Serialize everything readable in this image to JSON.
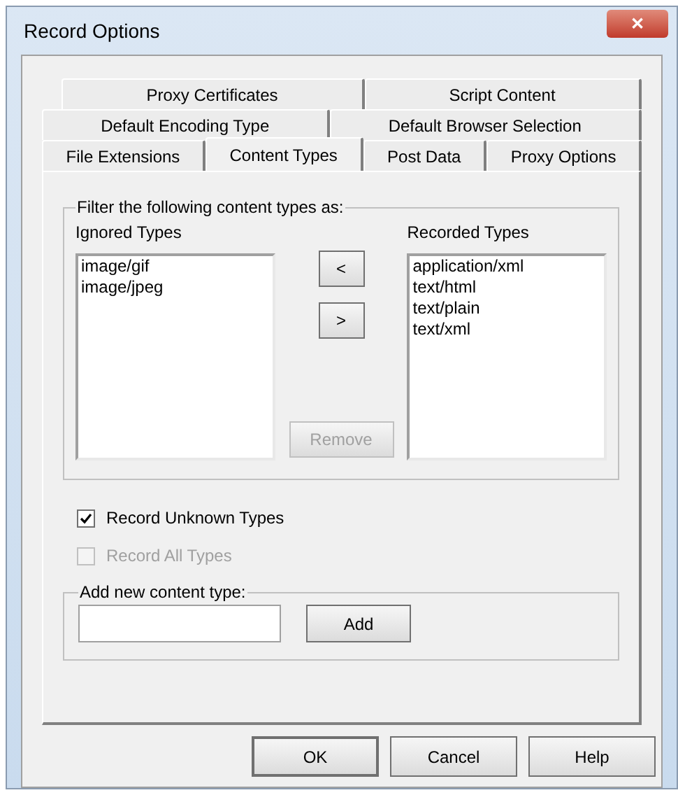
{
  "window": {
    "title": "Record Options",
    "close": "✕"
  },
  "tab_rows": [
    [
      {
        "label": "Proxy Certificates",
        "selected": false
      },
      {
        "label": "Script Content",
        "selected": false
      }
    ],
    [
      {
        "label": "Default Encoding Type",
        "selected": false
      },
      {
        "label": "Default Browser Selection",
        "selected": false
      }
    ],
    [
      {
        "label": "File Extensions",
        "selected": false
      },
      {
        "label": "Content Types",
        "selected": true
      },
      {
        "label": "Post Data",
        "selected": false
      },
      {
        "label": "Proxy Options",
        "selected": false
      }
    ]
  ],
  "filter_group": {
    "title": "Filter the following content types as:",
    "ignored": {
      "label": "Ignored Types",
      "items": [
        "image/gif",
        "image/jpeg"
      ]
    },
    "recorded": {
      "label": "Recorded Types",
      "items": [
        "application/xml",
        "text/html",
        "text/plain",
        "text/xml"
      ]
    },
    "move_left": "<",
    "move_right": ">",
    "remove": {
      "label": "Remove",
      "disabled": true
    }
  },
  "checkboxes": [
    {
      "label": "Record Unknown Types",
      "checked": true,
      "disabled": false
    },
    {
      "label": "Record All Types",
      "checked": false,
      "disabled": true
    }
  ],
  "add_group": {
    "title": "Add new content type:",
    "button": "Add"
  },
  "buttons": [
    "OK",
    "Cancel",
    "Help"
  ]
}
